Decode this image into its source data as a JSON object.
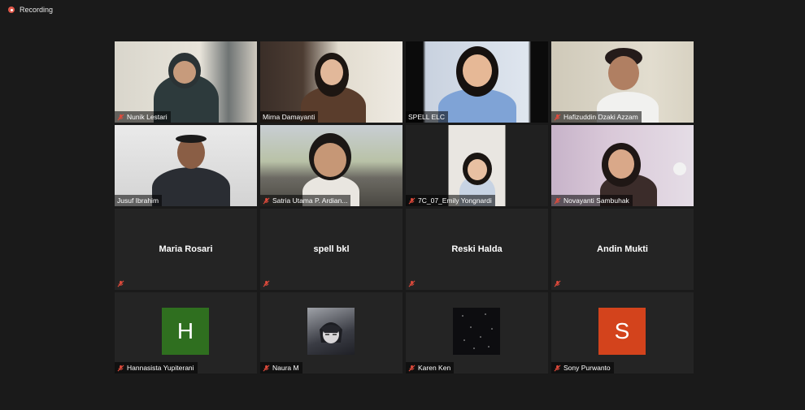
{
  "recording": {
    "label": "Recording"
  },
  "tiles": [
    {
      "name": "Nunik Lestari",
      "type": "video"
    },
    {
      "name": "Mirna Damayanti",
      "type": "video"
    },
    {
      "name": "SPELL ELC",
      "type": "video",
      "active": true
    },
    {
      "name": "Hafizuddin Dzaki Azzam",
      "type": "video"
    },
    {
      "name": "Jusuf Ibrahim",
      "type": "video"
    },
    {
      "name": "Satria Utama P. Ardian...",
      "type": "video"
    },
    {
      "name": "7C_07_Emily Yongnardi",
      "type": "video"
    },
    {
      "name": "Novayanti Sambuhak",
      "type": "video"
    },
    {
      "name": "Maria Rosari",
      "type": "name-only"
    },
    {
      "name": "spell bkl",
      "type": "name-only"
    },
    {
      "name": "Reski Halda",
      "type": "name-only"
    },
    {
      "name": "Andin Mukti",
      "type": "name-only"
    },
    {
      "name": "Hannasista Yupiterani",
      "type": "avatar",
      "avatar_letter": "H",
      "avatar_color": "#2f6f1f"
    },
    {
      "name": "Naura M",
      "type": "avatar-image"
    },
    {
      "name": "Karen Ken",
      "type": "avatar-image"
    },
    {
      "name": "Sony Purwanto",
      "type": "avatar",
      "avatar_letter": "S",
      "avatar_color": "#d3431c"
    }
  ],
  "colors": {
    "active_border": "#b7e04a",
    "muted_mic": "#e24b3c"
  }
}
